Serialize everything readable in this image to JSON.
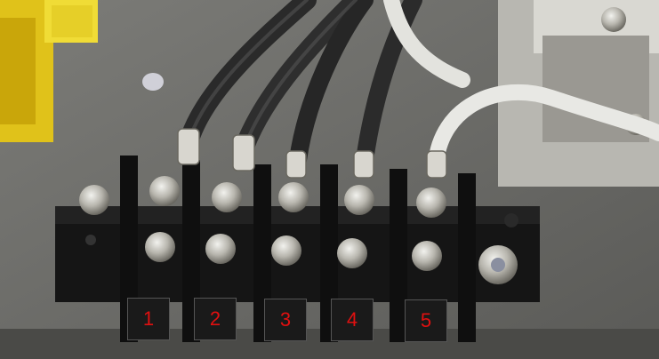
{
  "terminal_labels": [
    "1",
    "2",
    "3",
    "4",
    "5"
  ],
  "label_text_color": "#e01010",
  "label_background": "#1a1a1a"
}
